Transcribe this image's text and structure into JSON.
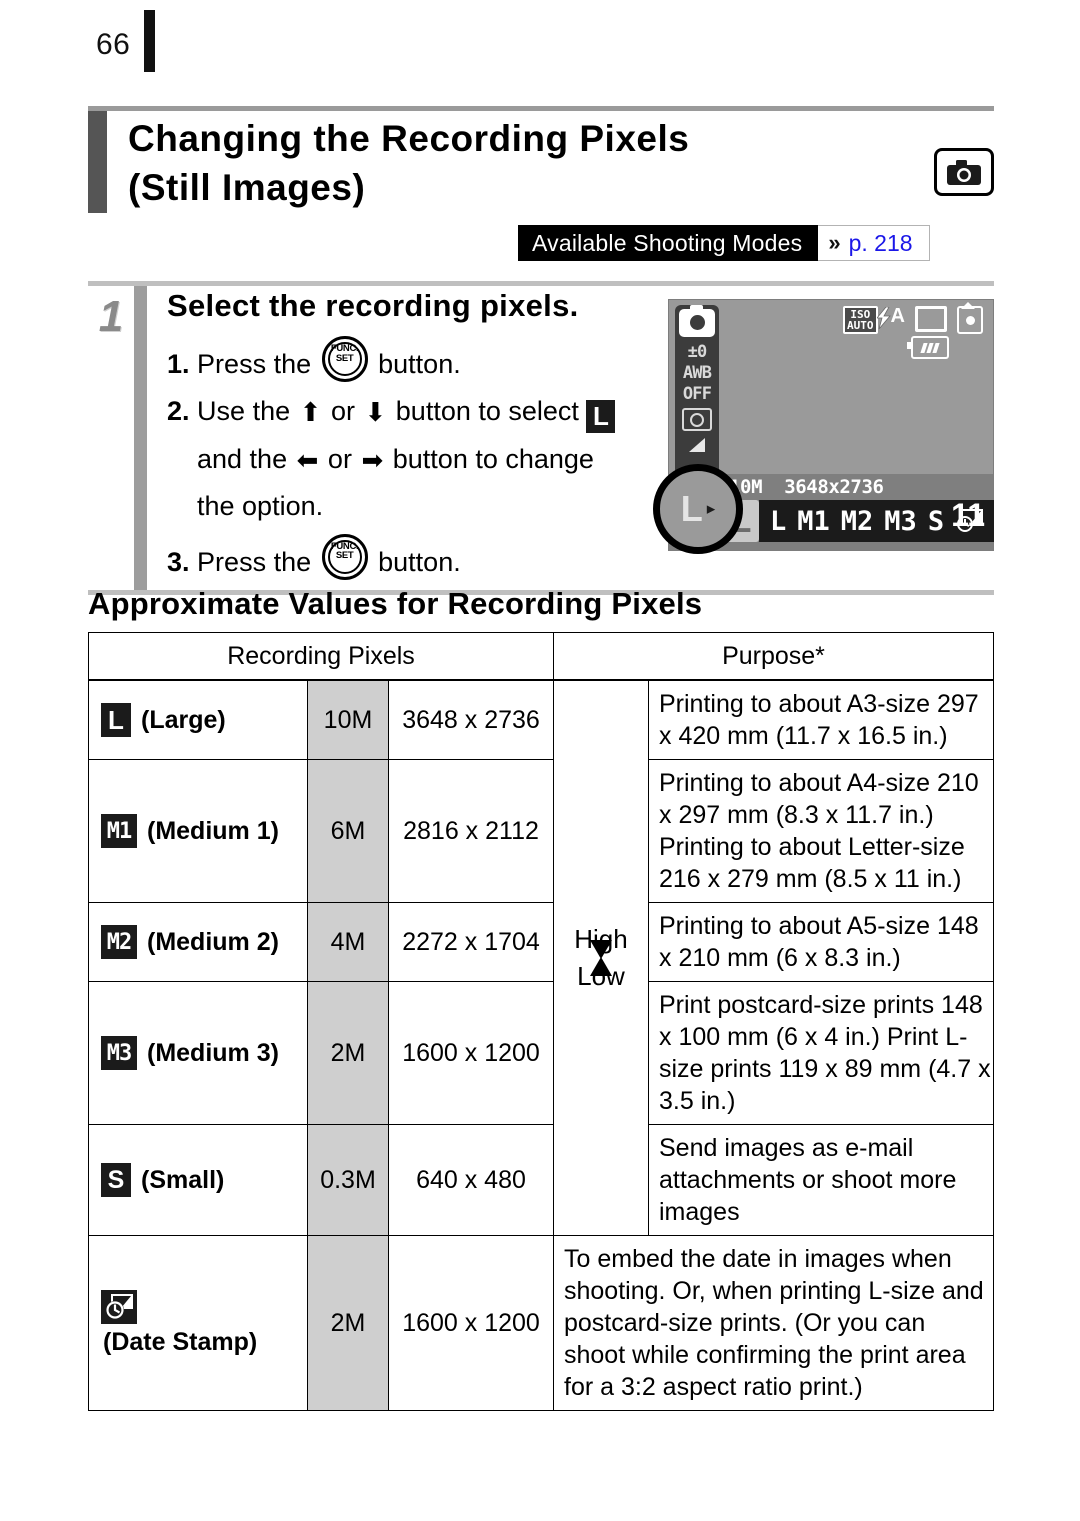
{
  "page": {
    "number": "66"
  },
  "title": {
    "line1": "Changing the Recording Pixels",
    "line2": "(Still Images)",
    "badge_icon": "camera-icon"
  },
  "modes_banner": {
    "label": "Available Shooting Modes",
    "chevron": "»",
    "page_ref": "p. 218",
    "ref_color": "#1b17e8"
  },
  "step": {
    "number": "1",
    "title": "Select the recording pixels.",
    "items": [
      {
        "num": "1.",
        "pre": "Press the",
        "post": "button."
      },
      {
        "num": "2.",
        "a": "Use the",
        "b": "or",
        "c": "button to select",
        "d": "and the",
        "e": "or",
        "f": "button to change",
        "g": "the option."
      },
      {
        "num": "3.",
        "pre": "Press the",
        "post": "button."
      }
    ],
    "icons": {
      "func_set_top": "FUNC.",
      "func_set_bottom": "SET",
      "up_arrow": "⬆",
      "down_arrow": "⬇",
      "left_arrow": "⬅",
      "right_arrow": "➡",
      "large_tag": "L"
    }
  },
  "lcd": {
    "side_icons": [
      "camera-mode-icon",
      "±0",
      "AWB",
      "OFF",
      "metering-icon",
      "flash-icon"
    ],
    "exposure": "±0",
    "white_balance": "AWB",
    "my_colors": "OFF",
    "iso_line1": "ISO",
    "iso_line2": "AUTO",
    "flash": "A",
    "resolution_label": "10M",
    "resolution_dims": "3648x2736",
    "options": [
      "L",
      "M1",
      "M2",
      "M3",
      "S",
      "date-stamp-icon"
    ],
    "selected_option": "L",
    "next_arrow": "▸",
    "shots_remaining": "11",
    "callout_label": "L"
  },
  "table": {
    "section_title": "Approximate Values for Recording Pixels",
    "headers": {
      "recording_pixels": "Recording Pixels",
      "purpose": "Purpose*"
    },
    "quality_scale": {
      "high": "High",
      "low": "Low"
    },
    "rows": [
      {
        "icon": "L",
        "icon_name": "large-icon",
        "label": "(Large)",
        "megapixels": "10M",
        "dimensions": "3648 x 2736",
        "purpose": "Printing to about A3-size 297 x 420 mm (11.7 x 16.5 in.)"
      },
      {
        "icon": "M1",
        "icon_name": "medium1-icon",
        "label": "(Medium 1)",
        "megapixels": "6M",
        "dimensions": "2816 x 2112",
        "purpose": "Printing to about A4-size 210 x 297 mm (8.3 x 11.7 in.) Printing to about Letter-size 216 x 279 mm (8.5 x 11 in.)"
      },
      {
        "icon": "M2",
        "icon_name": "medium2-icon",
        "label": "(Medium 2)",
        "megapixels": "4M",
        "dimensions": "2272 x 1704",
        "purpose": "Printing to about A5-size 148 x 210 mm (6 x 8.3 in.)"
      },
      {
        "icon": "M3",
        "icon_name": "medium3-icon",
        "label": "(Medium 3)",
        "megapixels": "2M",
        "dimensions": "1600 x 1200",
        "purpose": "Print postcard-size prints 148 x 100 mm (6 x 4 in.) Print L-size prints 119 x 89 mm (4.7 x 3.5 in.)"
      },
      {
        "icon": "S",
        "icon_name": "small-icon",
        "label": "(Small)",
        "megapixels": "0.3M",
        "dimensions": "640 x 480",
        "purpose": "Send images as e-mail attachments or shoot more images"
      },
      {
        "icon": "date-stamp-icon",
        "icon_name": "date-stamp-icon",
        "label": "(Date Stamp)",
        "megapixels": "2M",
        "dimensions": "1600 x 1200",
        "purpose": "To embed the date in images when shooting. Or, when printing L-size and postcard-size prints. (Or you can shoot while confirming the print area for a 3:2 aspect ratio print.)"
      }
    ]
  }
}
